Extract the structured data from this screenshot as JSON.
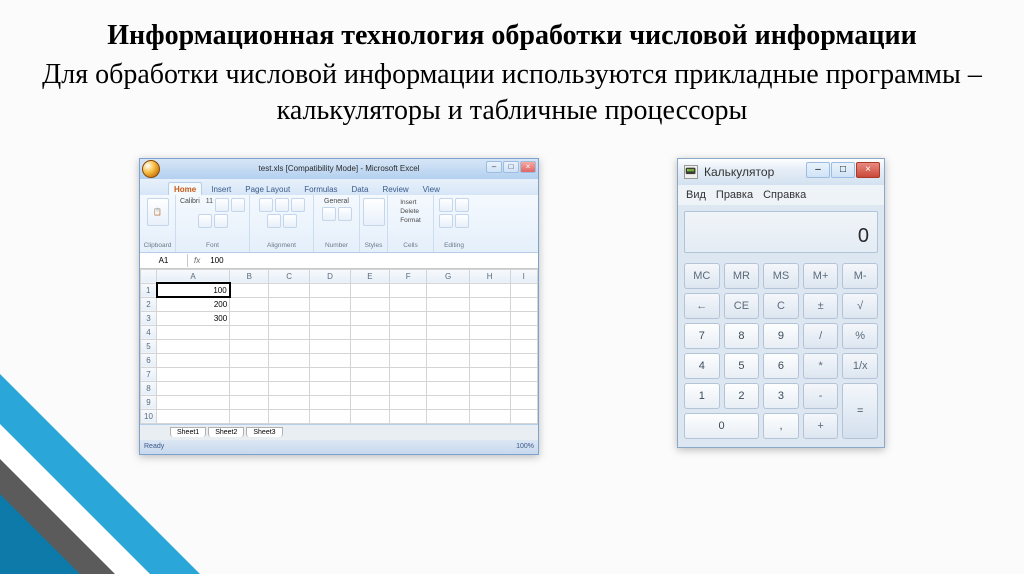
{
  "heading": "Информационная технология обработки числовой информации",
  "subtitle": "Для обработки числовой информации используются прикладные программы – калькуляторы и табличные процессоры",
  "excel": {
    "title": "test.xls [Compatibility Mode] - Microsoft Excel",
    "tabs": [
      "Home",
      "Insert",
      "Page Layout",
      "Formulas",
      "Data",
      "Review",
      "View"
    ],
    "ribbon_groups": [
      "Clipboard",
      "Font",
      "Alignment",
      "Number",
      "Styles",
      "Cells",
      "Editing"
    ],
    "font_name": "Calibri",
    "font_size": "11",
    "number_format": "General",
    "cells_items": [
      "Insert",
      "Delete",
      "Format"
    ],
    "namebox": "A1",
    "fx_label": "fx",
    "formula_value": "100",
    "columns": [
      "A",
      "B",
      "C",
      "D",
      "E",
      "F",
      "G",
      "H",
      "I"
    ],
    "rows": [
      {
        "n": "1",
        "A": "100"
      },
      {
        "n": "2",
        "A": "200"
      },
      {
        "n": "3",
        "A": "300"
      },
      {
        "n": "4",
        "A": ""
      },
      {
        "n": "5",
        "A": ""
      },
      {
        "n": "6",
        "A": ""
      },
      {
        "n": "7",
        "A": ""
      },
      {
        "n": "8",
        "A": ""
      },
      {
        "n": "9",
        "A": ""
      },
      {
        "n": "10",
        "A": ""
      }
    ],
    "sheets": [
      "Sheet1",
      "Sheet2",
      "Sheet3"
    ],
    "status_left": "Ready",
    "status_zoom": "100%"
  },
  "calc": {
    "title": "Калькулятор",
    "menu": [
      "Вид",
      "Правка",
      "Справка"
    ],
    "display": "0",
    "mem_keys": [
      "MC",
      "MR",
      "MS",
      "M+",
      "M-"
    ],
    "row2": [
      "←",
      "CE",
      "C",
      "±",
      "√"
    ],
    "row3": [
      "7",
      "8",
      "9",
      "/",
      "%"
    ],
    "row4": [
      "4",
      "5",
      "6",
      "*",
      "1/x"
    ],
    "row5": [
      "1",
      "2",
      "3",
      "-",
      "="
    ],
    "row6": [
      "0",
      ",",
      "+"
    ]
  }
}
